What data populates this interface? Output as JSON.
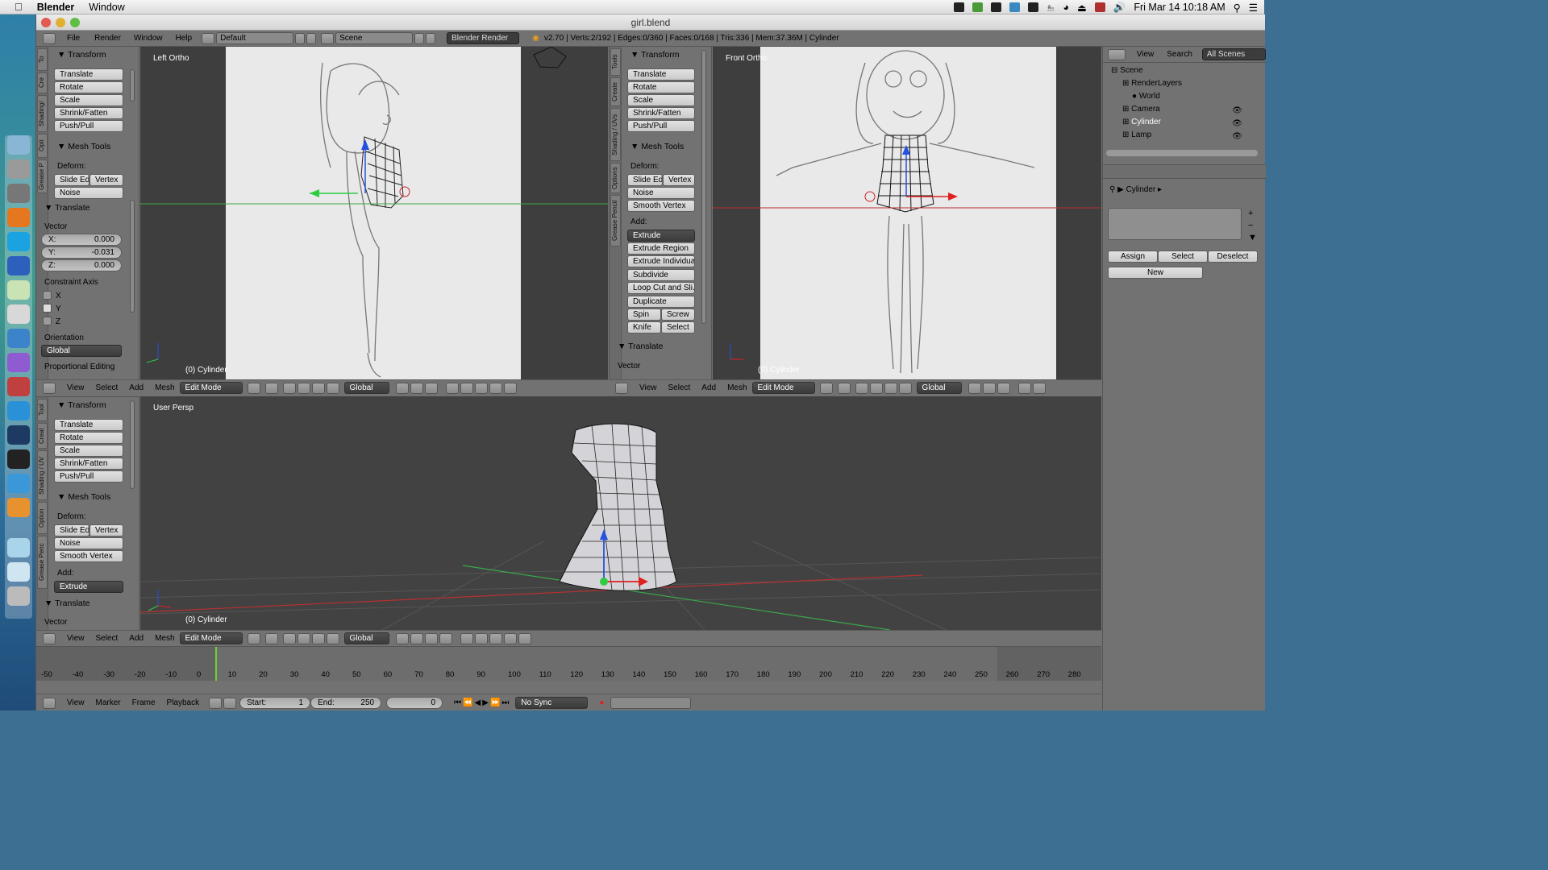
{
  "macbar": {
    "app": "Blender",
    "menu": "Window",
    "datetime": "Fri Mar 14  10:18 AM"
  },
  "window": {
    "title": "girl.blend"
  },
  "info": {
    "menus": [
      "File",
      "Render",
      "Window",
      "Help"
    ],
    "layout": "Default",
    "scene": "Scene",
    "engine": "Blender Render",
    "stats": "v2.70 | Verts:2/192 | Edges:0/360 | Faces:0/168 | Tris:336 | Mem:37.36M | Cylinder"
  },
  "left_panel": {
    "tabs": [
      "To",
      "Cre",
      "Shading/",
      "Opti",
      "Grease P"
    ],
    "transform_title": "Transform",
    "transform": [
      "Translate",
      "Rotate",
      "Scale",
      "Shrink/Fatten",
      "Push/Pull"
    ],
    "mesh_tools": "Mesh Tools",
    "deform": "Deform:",
    "slide": "Slide Ed",
    "vertex": "Vertex",
    "noise": "Noise",
    "translate_title": "Translate",
    "vector": "Vector",
    "x": {
      "label": "X:",
      "value": "0.000"
    },
    "y": {
      "label": "Y:",
      "value": "-0.031"
    },
    "z": {
      "label": "Z:",
      "value": "0.000"
    },
    "constraint": "Constraint Axis",
    "cx": "X",
    "cy": "Y",
    "cz": "Z",
    "orientation": "Orientation",
    "global": "Global",
    "proportional": "Proportional Editing"
  },
  "left_view": {
    "label": "Left Ortho",
    "object": "(0) Cylinder"
  },
  "mid_panel": {
    "tabs": [
      "Tools",
      "Create",
      "Shading / UVs",
      "Options",
      "Grease Pencil"
    ],
    "transform_title": "Transform",
    "transform": [
      "Translate",
      "Rotate",
      "Scale",
      "Shrink/Fatten",
      "Push/Pull"
    ],
    "mesh_tools": "Mesh Tools",
    "deform": "Deform:",
    "slide": "Slide Ed",
    "vertex": "Vertex",
    "noise": "Noise",
    "smooth": "Smooth Vertex",
    "add": "Add:",
    "extrude": "Extrude",
    "extrude_region": "Extrude Region",
    "extrude_individual": "Extrude Individual",
    "subdivide": "Subdivide",
    "loopcut": "Loop Cut and Sli...",
    "duplicate": "Duplicate",
    "spin": "Spin",
    "screw": "Screw",
    "knife": "Knife",
    "select": "Select",
    "translate_title": "Translate",
    "vector": "Vector"
  },
  "front_view": {
    "label": "Front Ortho",
    "object": "(0) Cylinder"
  },
  "bottom_panel": {
    "tabs": [
      "Tool",
      "Creat",
      "Shading / UV",
      "Option",
      "Grease Penc"
    ],
    "transform_title": "Transform",
    "transform": [
      "Translate",
      "Rotate",
      "Scale",
      "Shrink/Fatten",
      "Push/Pull"
    ],
    "mesh_tools": "Mesh Tools",
    "deform": "Deform:",
    "slide": "Slide Ed",
    "vertex": "Vertex",
    "noise": "Noise",
    "smooth": "Smooth Vertex",
    "add": "Add:",
    "extrude": "Extrude",
    "translate_title": "Translate",
    "vector": "Vector"
  },
  "persp_view": {
    "label": "User Persp",
    "object": "(0) Cylinder"
  },
  "header": {
    "view": "View",
    "select": "Select",
    "add": "Add",
    "mesh": "Mesh",
    "mode": "Edit Mode",
    "orientation": "Global"
  },
  "outliner": {
    "view": "View",
    "search": "Search",
    "scenes": "All Scenes",
    "items": [
      "Scene",
      "RenderLayers",
      "World",
      "Camera",
      "Cylinder",
      "Lamp"
    ]
  },
  "properties": {
    "object": "Cylinder",
    "assign": "Assign",
    "select": "Select",
    "deselect": "Deselect",
    "new": "New"
  },
  "timeline": {
    "ticks": [
      "-50",
      "-40",
      "-30",
      "-20",
      "-10",
      "0",
      "10",
      "20",
      "30",
      "40",
      "50",
      "60",
      "70",
      "80",
      "90",
      "100",
      "110",
      "120",
      "130",
      "140",
      "150",
      "160",
      "170",
      "180",
      "190",
      "200",
      "210",
      "220",
      "230",
      "240",
      "250",
      "260",
      "270",
      "280"
    ],
    "menus": [
      "View",
      "Marker",
      "Frame",
      "Playback"
    ],
    "start_label": "Start:",
    "start": "1",
    "end_label": "End:",
    "end": "250",
    "current": "0",
    "sync": "No Sync"
  }
}
